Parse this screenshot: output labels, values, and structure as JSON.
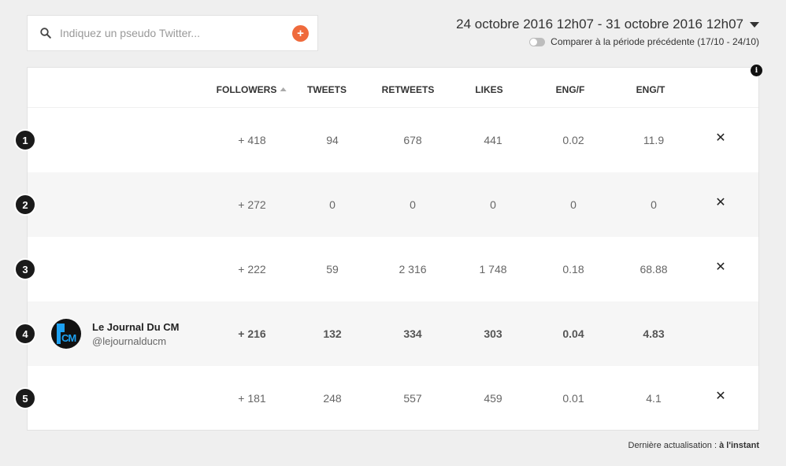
{
  "search": {
    "placeholder": "Indiquez un pseudo Twitter...",
    "add_label": "+"
  },
  "period": {
    "range": "24 octobre 2016 12h07 - 31 octobre 2016 12h07",
    "compare_label": "Comparer à la période précédente (17/10 - 24/10)"
  },
  "info_label": "i",
  "table": {
    "headers": {
      "followers": "FOLLOWERS",
      "tweets": "TWEETS",
      "retweets": "RETWEETS",
      "likes": "LIKES",
      "engf": "ENG/F",
      "engt": "ENG/T"
    },
    "rows": [
      {
        "rank": "1",
        "followers": "+ 418",
        "tweets": "94",
        "retweets": "678",
        "likes": "441",
        "engf": "0.02",
        "engt": "11.9",
        "remove": "✕"
      },
      {
        "rank": "2",
        "followers": "+ 272",
        "tweets": "0",
        "retweets": "0",
        "likes": "0",
        "engf": "0",
        "engt": "0",
        "remove": "✕"
      },
      {
        "rank": "3",
        "followers": "+ 222",
        "tweets": "59",
        "retweets": "2 316",
        "likes": "1 748",
        "engf": "0.18",
        "engt": "68.88",
        "remove": "✕"
      },
      {
        "rank": "4",
        "name": "Le Journal Du CM",
        "handle": "@lejournalducm",
        "avatar_text": "CM",
        "followers": "+ 216",
        "tweets": "132",
        "retweets": "334",
        "likes": "303",
        "engf": "0.04",
        "engt": "4.83"
      },
      {
        "rank": "5",
        "followers": "+ 181",
        "tweets": "248",
        "retweets": "557",
        "likes": "459",
        "engf": "0.01",
        "engt": "4.1",
        "remove": "✕"
      }
    ]
  },
  "footer": {
    "label": "Dernière actualisation :",
    "value": "à l'instant"
  },
  "colors": {
    "accent": "#ef6a3c",
    "rank_badge": "#1a1a1a",
    "background": "#efefef"
  }
}
